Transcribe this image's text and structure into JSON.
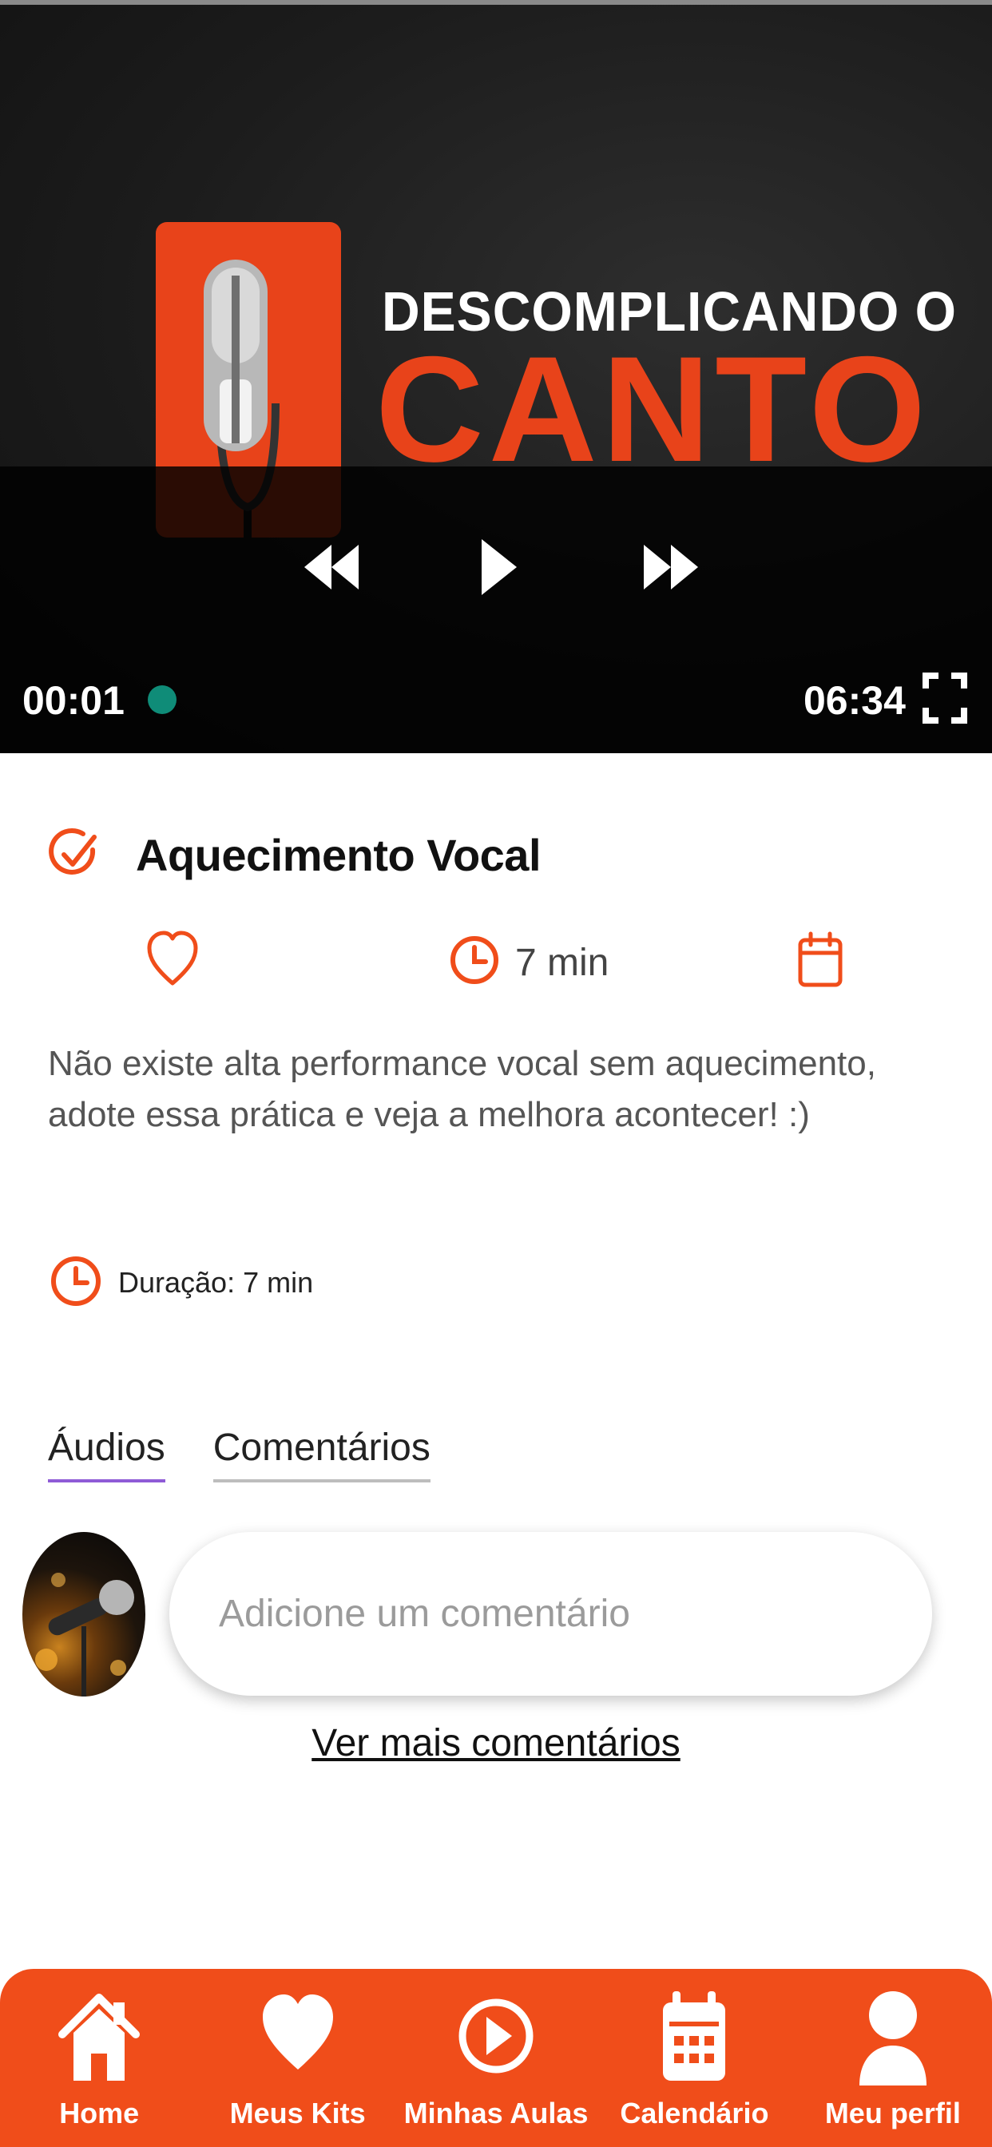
{
  "video": {
    "thumbnail_title_line1": "DESCOMPLICANDO O",
    "thumbnail_title_line2": "CANTO",
    "current_time": "00:01",
    "total_time": "06:34",
    "icons": {
      "rewind": "rewind-icon",
      "play": "play-icon",
      "forward": "fast-forward-icon",
      "fullscreen": "fullscreen-icon"
    }
  },
  "lesson": {
    "title": "Aquecimento Vocal",
    "duration_short": "7 min",
    "description": "Não existe alta performance vocal sem aquecimento, adote essa prática e veja a melhora acontecer! :)",
    "duration_line": "Duração: 7 min"
  },
  "tabs": [
    {
      "label": "Áudios",
      "active": true
    },
    {
      "label": "Comentários",
      "active": false
    }
  ],
  "comment": {
    "placeholder": "Adicione um comentário",
    "more_link": "Ver mais comentários"
  },
  "nav": [
    {
      "label": "Home",
      "icon": "home-icon"
    },
    {
      "label": "Meus Kits",
      "icon": "heart-icon"
    },
    {
      "label": "Minhas Aulas",
      "icon": "play-circle-icon"
    },
    {
      "label": "Calendário",
      "icon": "calendar-icon"
    },
    {
      "label": "Meu perfil",
      "icon": "user-icon"
    }
  ],
  "colors": {
    "accent": "#f04d1a",
    "tab_active": "#8f5bd6",
    "scrub": "#0f8c78"
  }
}
